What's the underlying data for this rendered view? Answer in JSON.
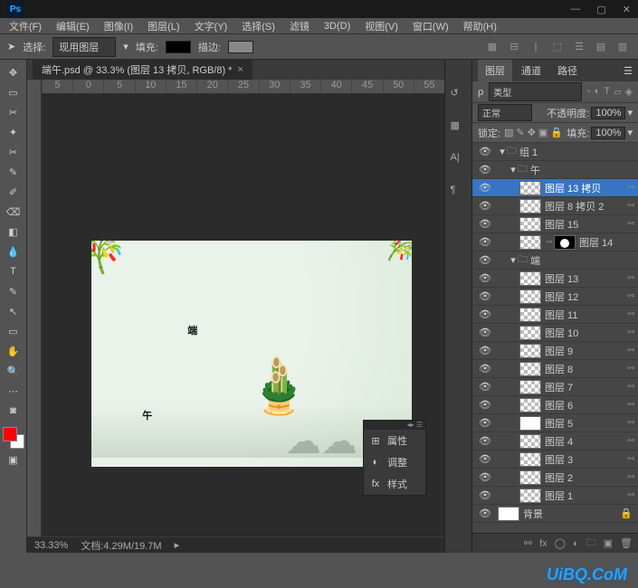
{
  "app": {
    "logo": "Ps"
  },
  "menu": [
    "文件(F)",
    "编辑(E)",
    "图像(I)",
    "图层(L)",
    "文字(Y)",
    "选择(S)",
    "滤镜",
    "3D(D)",
    "视图(V)",
    "窗口(W)",
    "帮助(H)"
  ],
  "options": {
    "select_label": "选择:",
    "select_value": "现用图层",
    "fill_label": "填充:",
    "stroke_label": "描边:"
  },
  "document": {
    "tab_title": "端午.psd @ 33.3% (图层 13 拷贝, RGB/8) *",
    "ruler_marks": [
      "5",
      "0",
      "5",
      "10",
      "15",
      "20",
      "25",
      "30",
      "35",
      "40",
      "45",
      "50",
      "55"
    ],
    "zoom": "33.33%",
    "doc_info": "文档:4.29M/19.7M"
  },
  "artboard": {
    "calligraphy_top": "端",
    "calligraphy_bot": "午"
  },
  "float_panel": {
    "items": [
      {
        "icon": "⊞",
        "label": "属性"
      },
      {
        "icon": "◐",
        "label": "调整"
      },
      {
        "icon": "fx",
        "label": "样式"
      }
    ]
  },
  "layers_panel": {
    "tabs": [
      "图层",
      "通道",
      "路径"
    ],
    "kind_label": "ρ",
    "kind_value": "类型",
    "blend_mode": "正常",
    "opacity_label": "不透明度:",
    "opacity_value": "100%",
    "lock_label": "锁定:",
    "fill_label": "填充:",
    "fill_value": "100%",
    "layers": [
      {
        "type": "group",
        "indent": 0,
        "name": "组 1",
        "open": true
      },
      {
        "type": "group",
        "indent": 1,
        "name": "午",
        "open": true
      },
      {
        "type": "layer",
        "indent": 2,
        "name": "图层 13 拷贝",
        "selected": true,
        "chain": true
      },
      {
        "type": "layer",
        "indent": 2,
        "name": "图层 8 拷贝 2",
        "chain": true
      },
      {
        "type": "layer",
        "indent": 2,
        "name": "图层 15",
        "chain": true
      },
      {
        "type": "layer-mask",
        "indent": 2,
        "name": "图层 14"
      },
      {
        "type": "group",
        "indent": 1,
        "name": "端",
        "open": true
      },
      {
        "type": "layer",
        "indent": 2,
        "name": "图层 13",
        "chain": true
      },
      {
        "type": "layer",
        "indent": 2,
        "name": "图层 12",
        "chain": true
      },
      {
        "type": "layer",
        "indent": 2,
        "name": "图层 11",
        "chain": true
      },
      {
        "type": "layer",
        "indent": 2,
        "name": "图层 10",
        "chain": true
      },
      {
        "type": "layer",
        "indent": 2,
        "name": "图层 9",
        "chain": true
      },
      {
        "type": "layer",
        "indent": 2,
        "name": "图层 8",
        "chain": true
      },
      {
        "type": "layer",
        "indent": 2,
        "name": "图层 7",
        "chain": true
      },
      {
        "type": "layer",
        "indent": 2,
        "name": "图层 6",
        "chain": true
      },
      {
        "type": "layer-white",
        "indent": 2,
        "name": "图层 5",
        "chain": true
      },
      {
        "type": "layer",
        "indent": 2,
        "name": "图层 4",
        "chain": true
      },
      {
        "type": "layer",
        "indent": 2,
        "name": "图层 3",
        "chain": true
      },
      {
        "type": "layer",
        "indent": 2,
        "name": "图层 2",
        "chain": true
      },
      {
        "type": "layer",
        "indent": 2,
        "name": "图层 1",
        "chain": true
      },
      {
        "type": "bg",
        "indent": 0,
        "name": "背景",
        "locked": true
      }
    ]
  },
  "colors": {
    "accent": "#3874c4",
    "fg": "#ff0000",
    "bg": "#ffffff"
  },
  "watermark": "UiBQ.CoM"
}
